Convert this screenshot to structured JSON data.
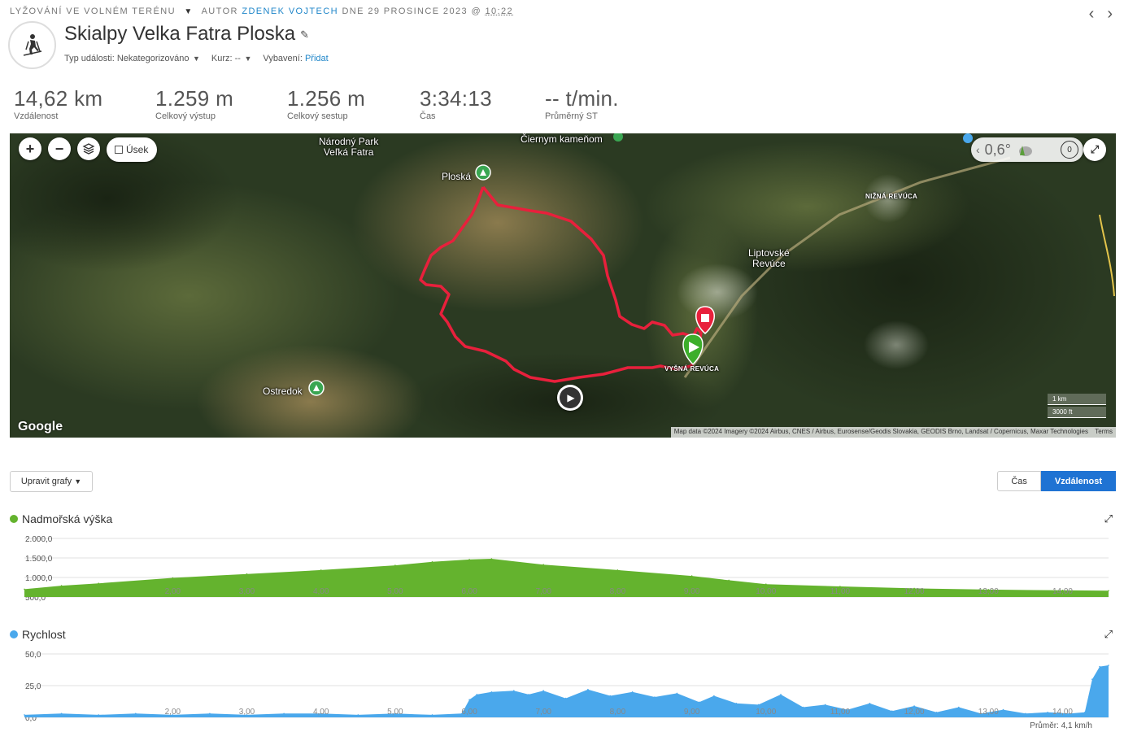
{
  "header": {
    "activity_type": "LYŽOVÁNÍ VE VOLNÉM TERÉNU",
    "author_prefix": "AUTOR",
    "author": "ZDENEK VOJTECH",
    "date": "DNE 29 PROSINCE 2023 @",
    "time": "10:22",
    "title": "Skialpy Velka Fatra Ploska",
    "event_type_label": "Typ události: Nekategorizováno",
    "course_label": "Kurz: --",
    "gear_label": "Vybavení:",
    "gear_add": "Přidat"
  },
  "stats": [
    {
      "value": "14,62 km",
      "label": "Vzdálenost"
    },
    {
      "value": "1.259 m",
      "label": "Celkový výstup"
    },
    {
      "value": "1.256 m",
      "label": "Celkový sestup"
    },
    {
      "value": "3:34:13",
      "label": "Čas"
    },
    {
      "value": "-- t/min.",
      "label": "Průměrný ST"
    }
  ],
  "map": {
    "segment_label": "Úsek",
    "temperature": "0,6°",
    "wind": "0",
    "labels": {
      "park": "Národný Park\nVeľká Fatra",
      "ridge": "Čiernym kameňom",
      "ploska": "Ploská",
      "nizna": "NIŽNÁ REVÚCA",
      "liptovske": "Liptovské\nRevúce",
      "vysna": "VYŠNÁ REVÚCA",
      "ostredok": "Ostredok"
    },
    "google": "Google",
    "scale_km": "1 km",
    "scale_ft": "3000 ft",
    "attribution": "Map data ©2024 Imagery ©2024 Airbus, CNES / Airbus, Eurosense/Geodis Slovakia, GEODIS Brno, Landsat / Copernicus, Maxar Technologies",
    "terms": "Terms"
  },
  "controls": {
    "edit_charts": "Upravit grafy",
    "toggle_time": "Čas",
    "toggle_distance": "Vzdálenost"
  },
  "colors": {
    "elevation": "#64b32e",
    "speed": "#4aa8ec",
    "route": "#e8203c"
  },
  "chart_data": [
    {
      "type": "area",
      "title": "Nadmořská výška",
      "x": [
        0,
        0.5,
        1,
        2,
        3,
        4,
        5,
        5.5,
        6,
        6.3,
        7,
        8,
        9,
        9.5,
        10,
        11,
        12,
        13,
        14,
        14.62
      ],
      "values": [
        700,
        790,
        850,
        990,
        1090,
        1190,
        1310,
        1400,
        1460,
        1480,
        1330,
        1190,
        1040,
        930,
        830,
        770,
        720,
        690,
        670,
        660
      ],
      "yticks": [
        "2.000,0",
        "1.500,0",
        "1.000,0",
        "500,0"
      ],
      "ylim": [
        500,
        2000
      ],
      "xticks": [
        "2,00",
        "3,00",
        "4,00",
        "5,00",
        "6,00",
        "7,00",
        "8,00",
        "9,00",
        "10,00",
        "11,00",
        "12,00",
        "13,00",
        "14,00"
      ],
      "xlim": [
        0,
        14.62
      ]
    },
    {
      "type": "area",
      "title": "Rychlost",
      "x": [
        0,
        0.5,
        1,
        1.5,
        2,
        2.5,
        3,
        3.5,
        4,
        4.5,
        5,
        5.5,
        5.9,
        6.0,
        6.1,
        6.3,
        6.6,
        6.8,
        7.0,
        7.3,
        7.6,
        7.9,
        8.2,
        8.5,
        8.8,
        9.1,
        9.3,
        9.6,
        9.9,
        10.2,
        10.5,
        10.8,
        11.1,
        11.4,
        11.7,
        12.0,
        12.3,
        12.6,
        12.9,
        13.2,
        13.5,
        13.8,
        14.1,
        14.3,
        14.4,
        14.5,
        14.62
      ],
      "values": [
        2,
        3,
        2,
        3,
        2,
        3,
        2,
        3,
        3,
        2,
        3,
        2,
        3,
        14,
        18,
        20,
        21,
        18,
        21,
        15,
        22,
        17,
        20,
        16,
        19,
        12,
        17,
        11,
        10,
        18,
        8,
        10,
        6,
        11,
        5,
        9,
        4,
        8,
        3,
        6,
        3,
        4,
        3,
        4,
        30,
        40,
        41
      ],
      "yticks": [
        "50,0",
        "25,0",
        "0,0"
      ],
      "ylim": [
        0,
        50
      ],
      "xticks": [
        "2,00",
        "3,00",
        "4,00",
        "5,00",
        "6,00",
        "7,00",
        "8,00",
        "9,00",
        "10,00",
        "11,00",
        "12,00",
        "13,00",
        "14,00"
      ],
      "xlim": [
        0,
        14.62
      ],
      "average_label": "Průměr: 4,1 km/h"
    }
  ]
}
